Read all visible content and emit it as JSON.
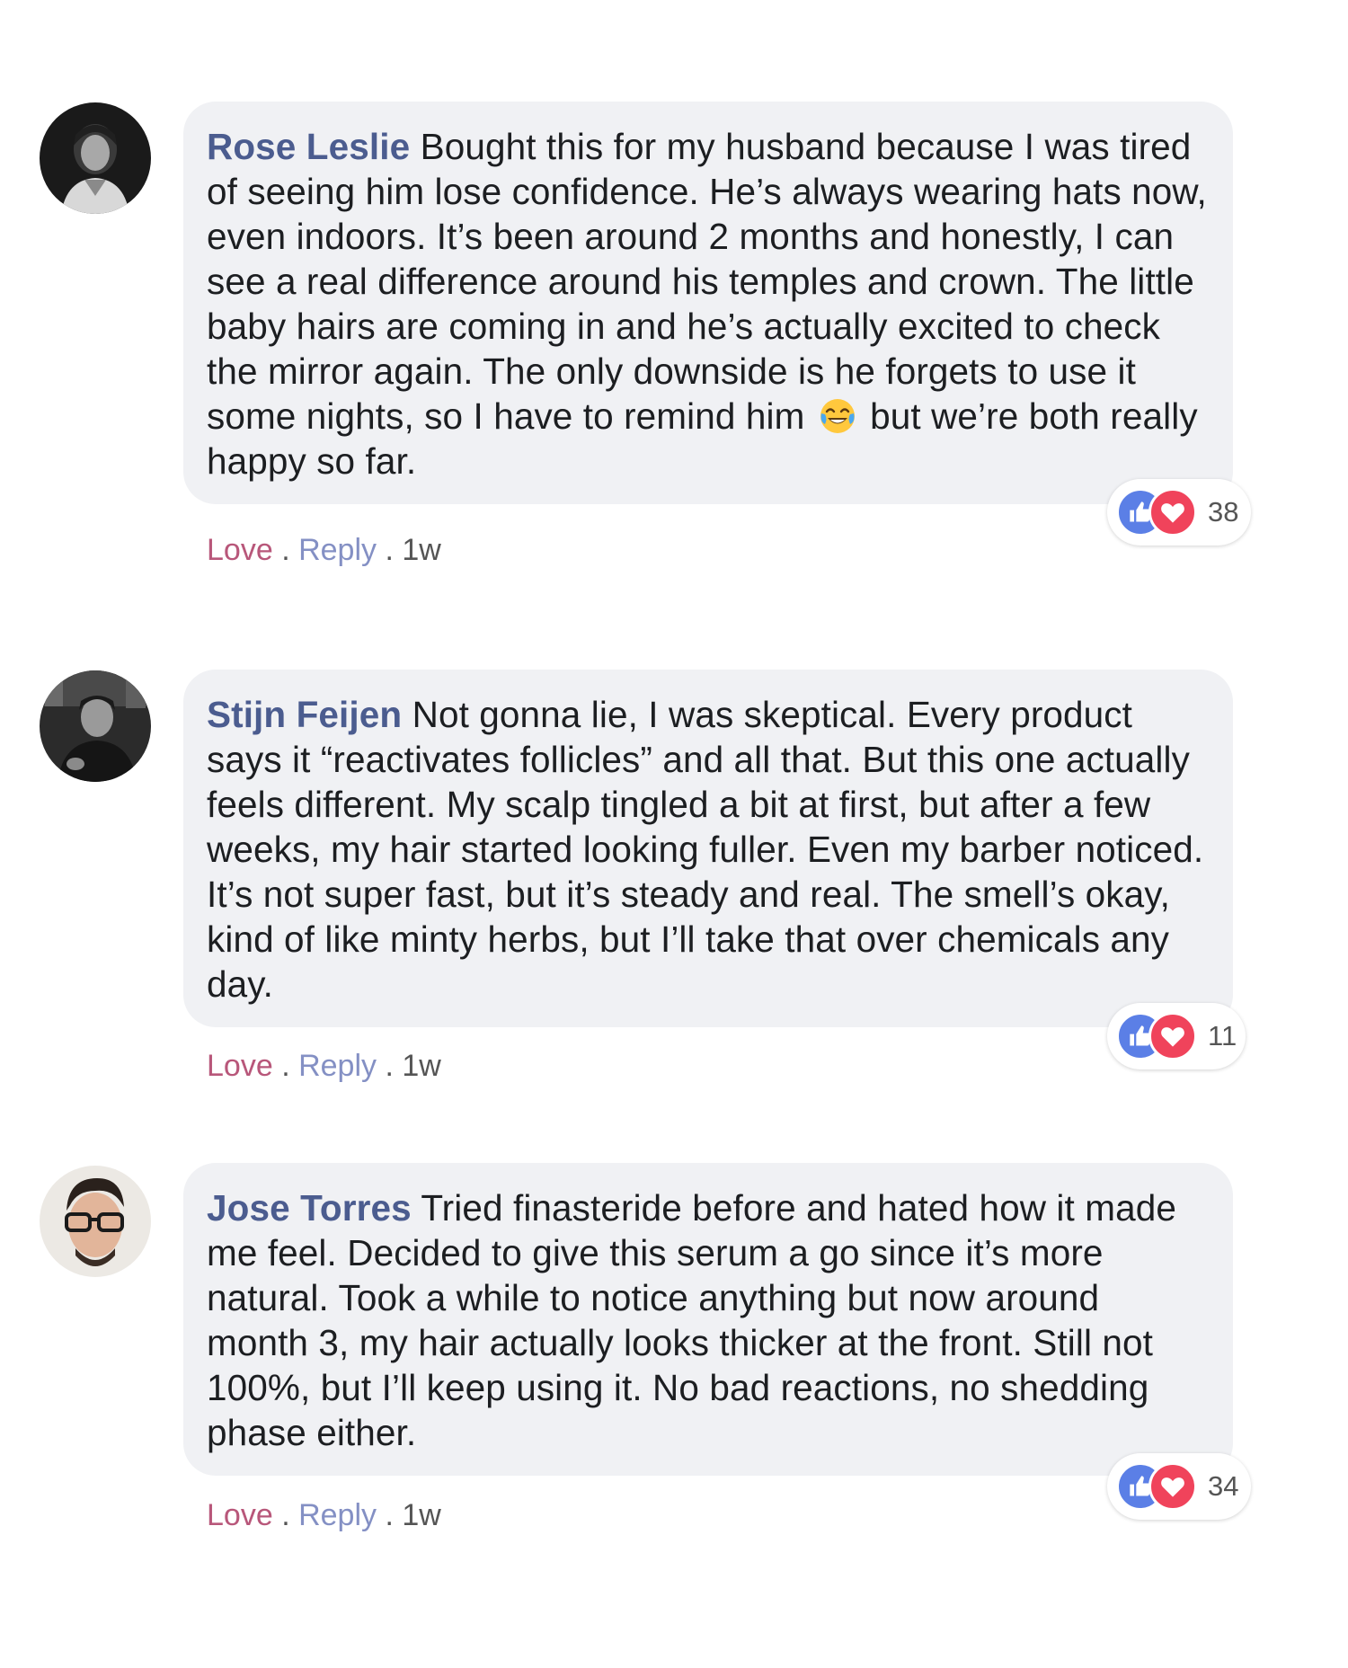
{
  "comments": [
    {
      "author": "Rose Leslie",
      "text": "Bought this for my husband because I was tired of seeing him lose confidence. He’s always wearing hats now, even indoors. It’s been around 2 months and honestly, I can see a real difference around his temples and crown. The little baby hairs are coming in and he’s actually excited to check the mirror again. The only downside is he forgets to use it some nights, so I have to remind him",
      "emoji": "face-with-tears-of-joy-icon",
      "text_after_emoji": "but we’re both really happy so far.",
      "reaction_count": "38",
      "love_label": "Love",
      "reply_label": "Reply",
      "separator": ".",
      "time": "1w"
    },
    {
      "author": "Stijn Feijen",
      "text": "Not gonna lie, I was skeptical. Every product says it “reactivates follicles” and all that. But this one actually feels different. My scalp tingled a bit at first, but after a few weeks, my hair started looking fuller. Even my barber noticed. It’s not super fast, but it’s steady and real. The smell’s okay, kind of like minty herbs, but I’ll take that over chemicals any day.",
      "reaction_count": "11",
      "love_label": "Love",
      "reply_label": "Reply",
      "separator": ".",
      "time": "1w"
    },
    {
      "author": "Jose Torres",
      "text": "Tried finasteride before and hated how it made me feel. Decided to give this serum a go since it’s more natural. Took a while to notice anything but now around month 3, my hair actually looks thicker at the front. Still not 100%, but I’ll keep using it. No bad reactions, no shedding phase either.",
      "reaction_count": "34",
      "love_label": "Love",
      "reply_label": "Reply",
      "separator": ".",
      "time": "1w"
    }
  ],
  "icons": {
    "like": "thumbs-up-icon",
    "love": "heart-icon"
  },
  "colors": {
    "author": "#4b5c8f",
    "bubble": "#f0f1f4",
    "love_link": "#b8577a",
    "reply_link": "#8490c4",
    "like_reaction": "#5b7fe6",
    "love_reaction": "#f0435b"
  }
}
